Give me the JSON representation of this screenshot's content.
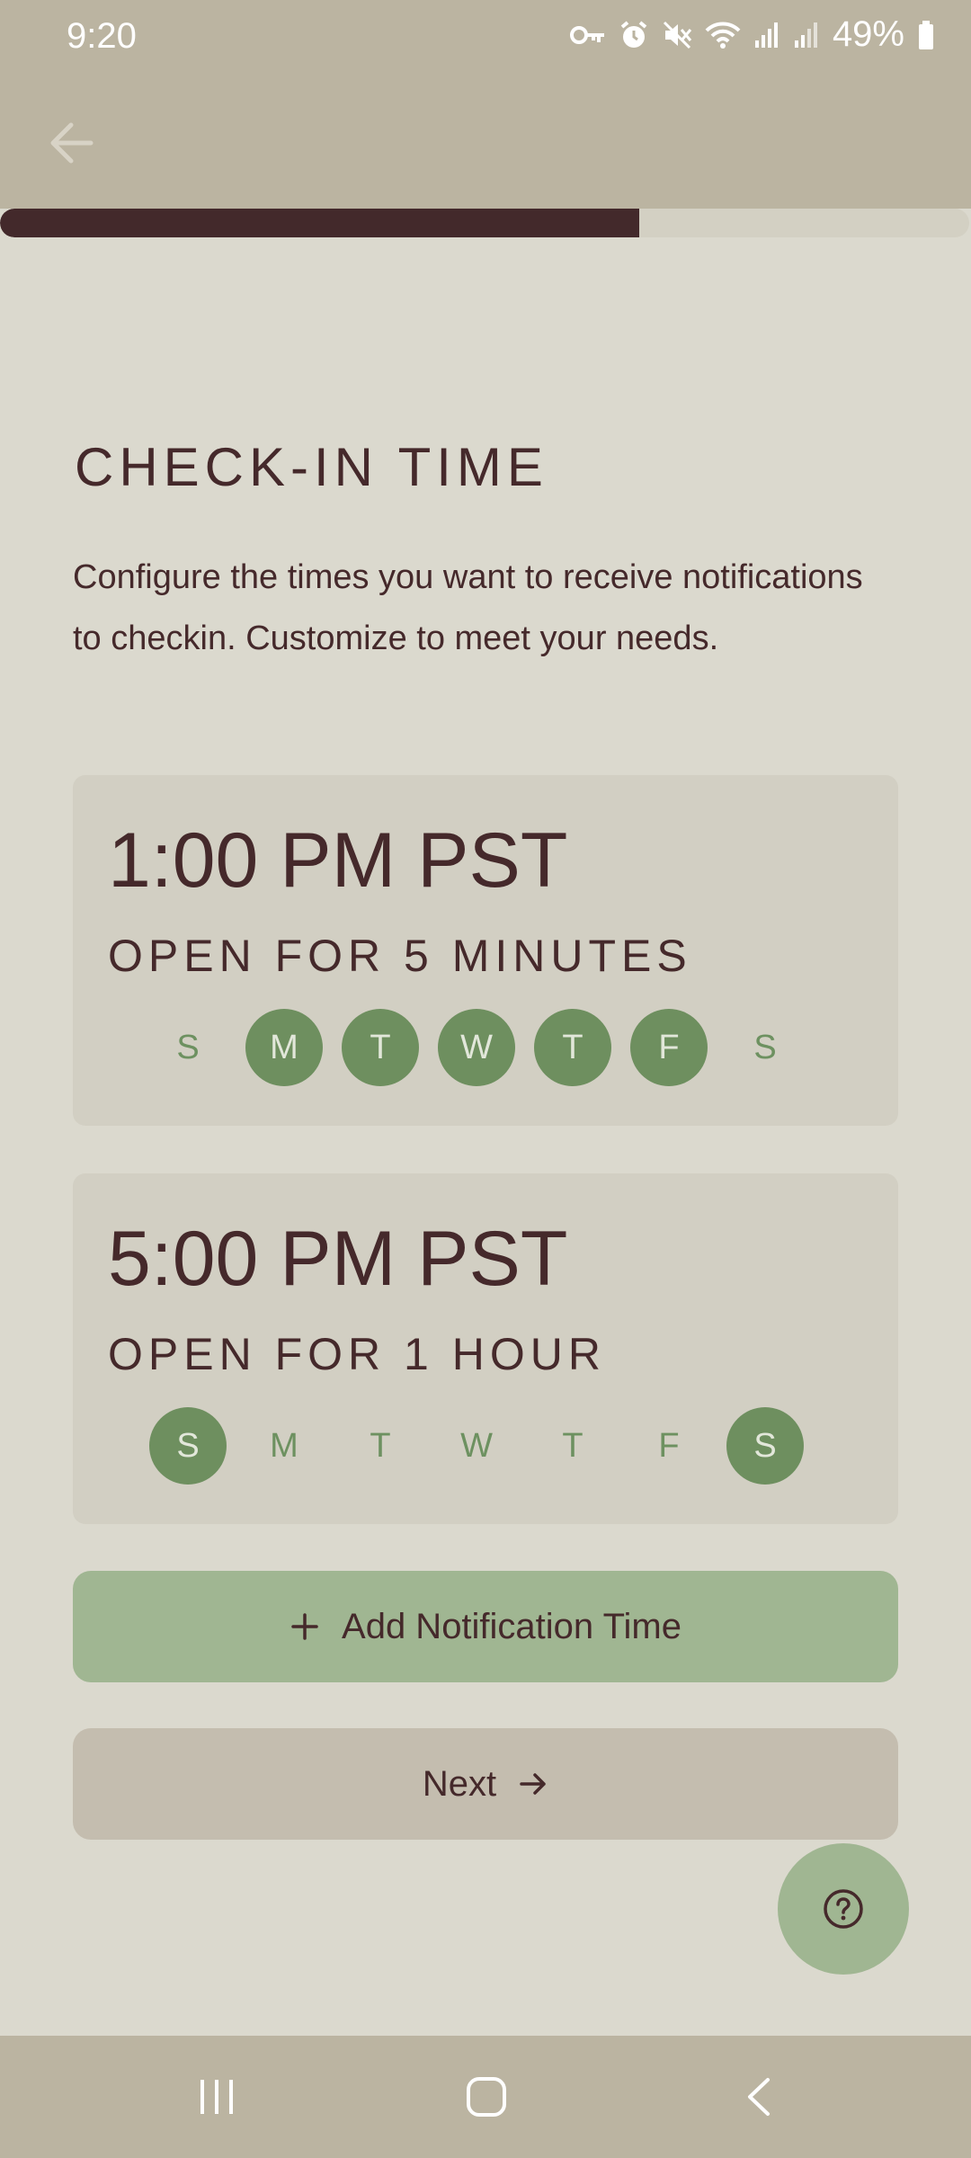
{
  "status_bar": {
    "time": "9:20",
    "battery_percent": "49%",
    "icons": [
      "vpn-key-icon",
      "alarm-icon",
      "mute-icon",
      "wifi-icon",
      "signal-icon",
      "signal-icon",
      "battery-icon"
    ]
  },
  "header": {
    "back_icon": "arrow-left-icon",
    "progress": 0.66
  },
  "page": {
    "title": "CHECK-IN TIME",
    "description": "Configure the times you want to receive notifications to checkin. Customize to meet your needs."
  },
  "notifications": [
    {
      "time": "1:00 PM PST",
      "duration": "OPEN FOR 5 MINUTES",
      "days": [
        {
          "label": "S",
          "selected": false
        },
        {
          "label": "M",
          "selected": true
        },
        {
          "label": "T",
          "selected": true
        },
        {
          "label": "W",
          "selected": true
        },
        {
          "label": "T",
          "selected": true
        },
        {
          "label": "F",
          "selected": true
        },
        {
          "label": "S",
          "selected": false
        }
      ]
    },
    {
      "time": "5:00 PM PST",
      "duration": "OPEN FOR 1 HOUR",
      "days": [
        {
          "label": "S",
          "selected": true
        },
        {
          "label": "M",
          "selected": false
        },
        {
          "label": "T",
          "selected": false
        },
        {
          "label": "W",
          "selected": false
        },
        {
          "label": "T",
          "selected": false
        },
        {
          "label": "F",
          "selected": false
        },
        {
          "label": "S",
          "selected": true
        }
      ]
    }
  ],
  "actions": {
    "add_label": "Add Notification Time",
    "add_icon": "plus-icon",
    "next_label": "Next",
    "next_icon": "arrow-right-icon",
    "help_icon": "help-circle-icon"
  },
  "colors": {
    "background": "#dbd9ce",
    "bar": "#bbb4a1",
    "text": "#45292b",
    "accent_green": "#6e8f5f",
    "light_green": "#a0b692"
  }
}
